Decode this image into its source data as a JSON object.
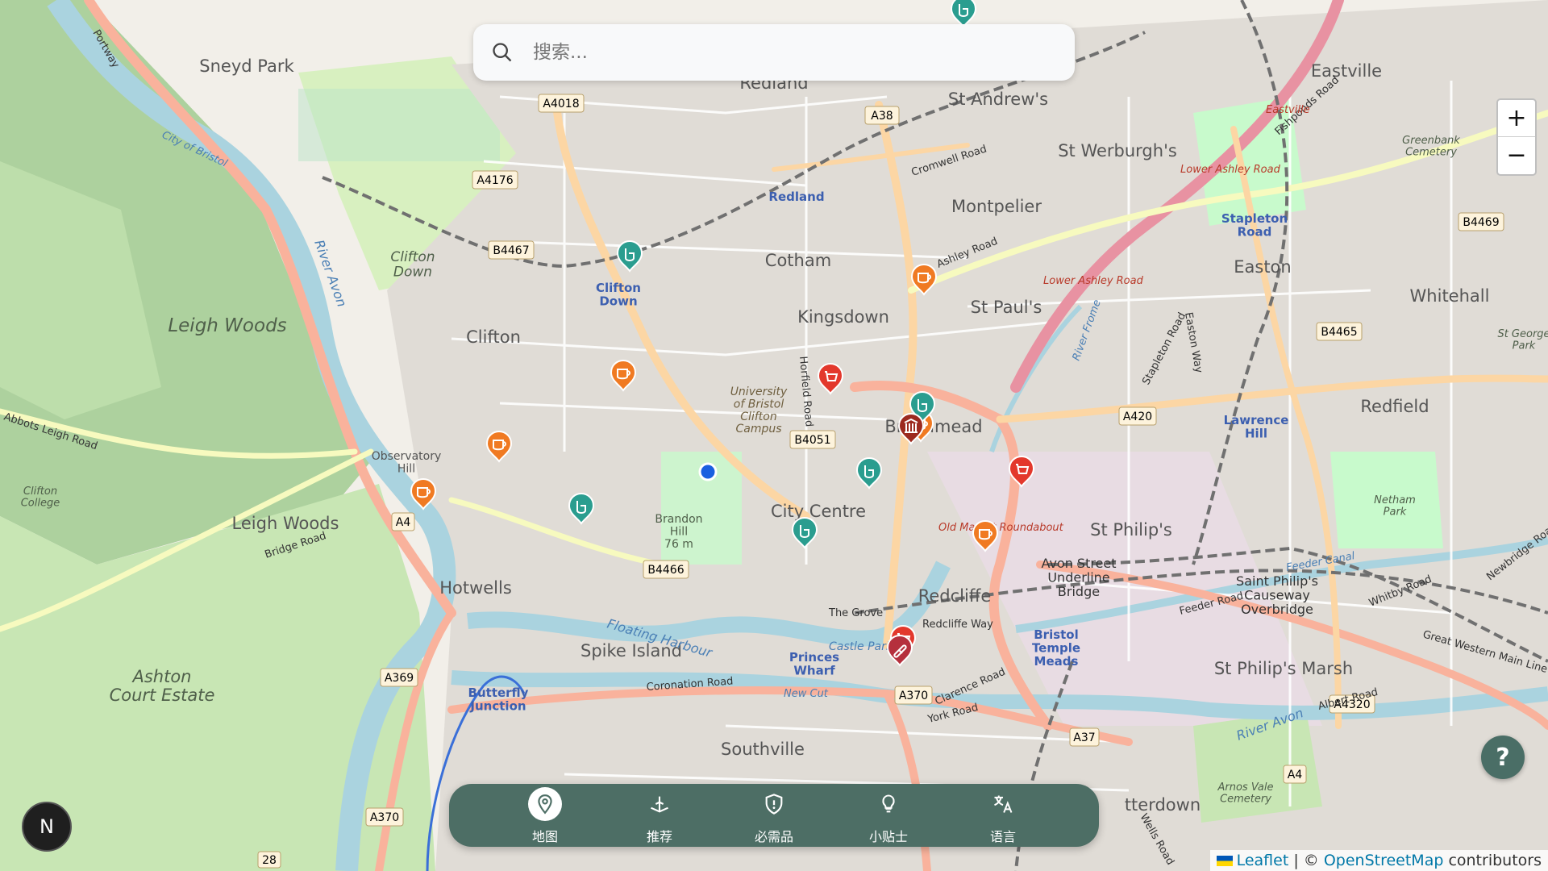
{
  "search": {
    "placeholder": "搜索..."
  },
  "zoom": {
    "in_label": "+",
    "out_label": "−"
  },
  "help": {
    "label": "?"
  },
  "compass": {
    "label": "N"
  },
  "nav": {
    "items": [
      {
        "label": "地图",
        "icon": "map-pin-icon",
        "active": true
      },
      {
        "label": "推荐",
        "icon": "recommend-icon",
        "active": false
      },
      {
        "label": "必需品",
        "icon": "shield-icon",
        "active": false
      },
      {
        "label": "小贴士",
        "icon": "lightbulb-icon",
        "active": false
      },
      {
        "label": "语言",
        "icon": "translate-icon",
        "active": false
      }
    ]
  },
  "attribution": {
    "leaflet": "Leaflet",
    "separator": " | © ",
    "osm": "OpenStreetMap",
    "suffix": " contributors"
  },
  "map": {
    "places": {
      "sneyd_park": "Sneyd Park",
      "redland_top": "Redland",
      "st_andrews": "St Andrew's",
      "eastville": "Eastville",
      "st_werburghs": "St Werburgh's",
      "montpelier": "Montpelier",
      "cotham": "Cotham",
      "kingsdown": "Kingsdown",
      "st_pauls": "St Paul's",
      "easton": "Easton",
      "whitehall": "Whitehall",
      "clifton": "Clifton",
      "clifton_down": "Clifton\nDown",
      "leigh_woods_big": "Leigh Woods",
      "leigh_woods": "Leigh Woods",
      "redfield": "Redfield",
      "broadmead": "Broadmead",
      "city_centre": "City Centre",
      "st_philips": "St Philip's",
      "hotwells": "Hotwells",
      "redcliffe": "Redcliffe",
      "spike_island": "Spike Island",
      "st_philips_marsh": "St Philip's Marsh",
      "southville": "Southville",
      "ashton_court": "Ashton\nCourt Estate",
      "bedminster": "tterdown",
      "observatory": "Observatory\nHill",
      "clifton_college": "Clifton\nCollege",
      "brandon_hill": "Brandon\nHill\n76 m",
      "university": "University\nof Bristol\nClifton\nCampus",
      "greenbank": "Greenbank\nCemetery",
      "netham": "Netham\nPark",
      "arnos": "Arnos Vale\nCemetery",
      "st_george": "St George\nPark",
      "avon_street": "Avon Street\nUnderline\nBridge",
      "causeway": "Saint Philip's\nCauseway\nOverbridge"
    },
    "stations": {
      "redland": "Redland",
      "clifton_down": "Clifton\nDown",
      "stapleton_road": "Stapleton\nRoad",
      "lawrence_hill": "Lawrence\nHill",
      "temple_meads": "Bristol\nTemple\nMeads",
      "princes_wharf": "Princes\nWharf",
      "butterfly": "Butterfly\nJunction"
    },
    "roads": {
      "a4018": "A4018",
      "a38": "A38",
      "a4176": "A4176",
      "b4467": "B4467",
      "b4051": "B4051",
      "a4": "A4",
      "b4466": "B4466",
      "a369": "A369",
      "a370": "A370",
      "a370b": "A370",
      "a420": "A420",
      "b4465": "B4465",
      "b4469": "B4469",
      "a4320": "A4320",
      "a37": "A37",
      "a4b": "A4",
      "r28": "28",
      "portway": "Portway",
      "abbots": "Abbots Leigh Road",
      "bridge_road": "Bridge Road",
      "cromwell": "Cromwell Road",
      "ashley": "Ashley Road",
      "lower_ashley": "Lower Ashley Road",
      "lower_ashley2": "Lower Ashley Road",
      "fishponds": "Fishponds Road",
      "stapleton": "Stapleton Road",
      "easton_way": "Easton Way",
      "coronation": "Coronation Road",
      "the_grove": "The Grove",
      "redcliffe_way": "Redcliffe Way",
      "old_market": "Old Market Roundabout",
      "feeder": "Feeder Road",
      "whitby": "Whitby Road",
      "albert": "Albert Road",
      "clarence": "Clarence Road",
      "york": "York Road",
      "wells": "Wells Road",
      "newbridge": "Newbridge Road",
      "great_western": "Great Western Main Line",
      "horfield": "Horfield Road",
      "eastville_red": "Eastville"
    },
    "water": {
      "floating_harbour": "Floating Harbour",
      "new_cut": "New Cut",
      "river_avon": "River Avon",
      "river_avon_e": "River Avon",
      "feeder_canal": "Feeder Canal",
      "river_frome": "River Frome",
      "city_of_bristol": "City of Bristol",
      "castle_park": "Castle Park"
    },
    "colors": {
      "background": "#f2efe9",
      "park": "#c8facc",
      "wood": "#add19e",
      "water": "#aad3df",
      "primary": "#fcd6a4",
      "trunk": "#f9b29c",
      "rail": "#555555"
    }
  },
  "markers": [
    {
      "name": "poi-marker-shop",
      "kind": "shop",
      "color": "#e3382c"
    },
    {
      "name": "poi-marker-shop",
      "kind": "shop",
      "color": "#e3382c"
    },
    {
      "name": "poi-marker-shop",
      "kind": "shop",
      "color": "#e3382c"
    },
    {
      "name": "poi-marker-cafe",
      "kind": "cafe",
      "color": "#f07a22"
    },
    {
      "name": "poi-marker-cafe",
      "kind": "cafe",
      "color": "#f07a22"
    },
    {
      "name": "poi-marker-cafe",
      "kind": "cafe",
      "color": "#f07a22"
    },
    {
      "name": "poi-marker-cafe",
      "kind": "cafe",
      "color": "#f07a22"
    },
    {
      "name": "poi-marker-cafe",
      "kind": "cafe",
      "color": "#f07a22"
    },
    {
      "name": "poi-marker-cafe",
      "kind": "cafe",
      "color": "#f07a22"
    },
    {
      "name": "poi-marker-toilet",
      "kind": "toilet",
      "color": "#2a9d8f"
    },
    {
      "name": "poi-marker-toilet",
      "kind": "toilet",
      "color": "#2a9d8f"
    },
    {
      "name": "poi-marker-toilet",
      "kind": "toilet",
      "color": "#2a9d8f"
    },
    {
      "name": "poi-marker-toilet",
      "kind": "toilet",
      "color": "#2a9d8f"
    },
    {
      "name": "poi-marker-toilet",
      "kind": "toilet",
      "color": "#2a9d8f"
    },
    {
      "name": "poi-marker-toilet",
      "kind": "toilet",
      "color": "#2a9d8f"
    },
    {
      "name": "poi-marker-museum",
      "kind": "museum",
      "color": "#9c2a1f"
    },
    {
      "name": "poi-marker-pharmacy",
      "kind": "pharmacy",
      "color": "#b5303d"
    }
  ]
}
